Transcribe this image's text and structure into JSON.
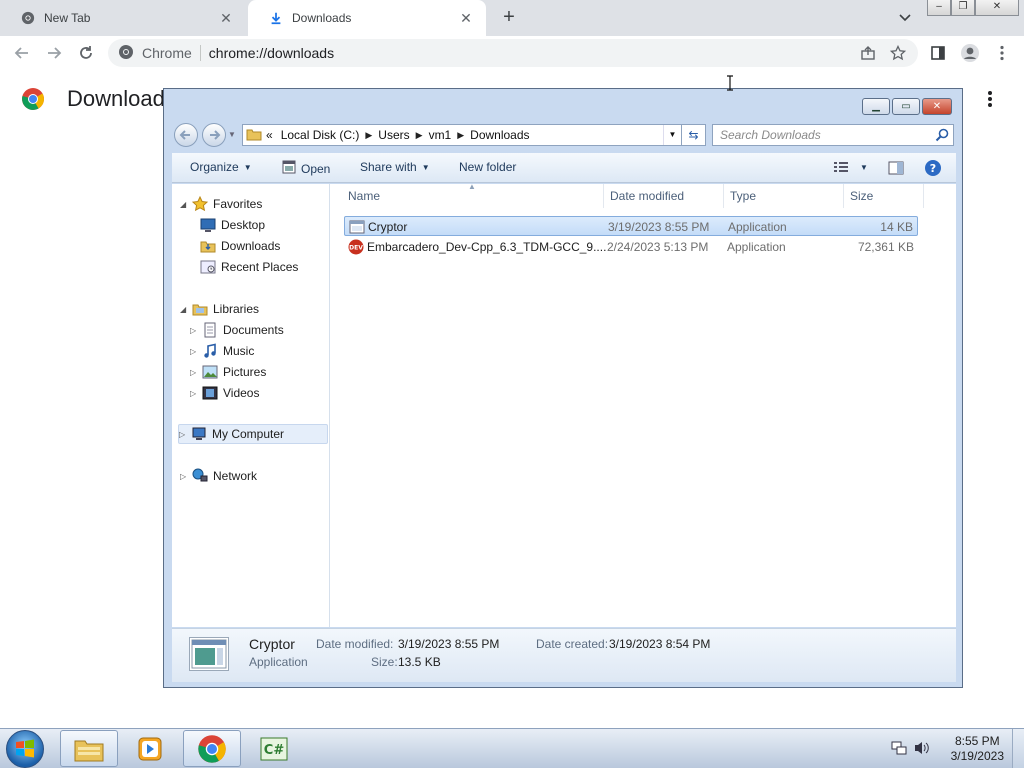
{
  "tabs": [
    {
      "title": "New Tab",
      "close": "✕"
    },
    {
      "title": "Downloads",
      "close": "✕"
    }
  ],
  "new_tab_label": "+",
  "omnibox": {
    "site": "Chrome",
    "url": "chrome://downloads"
  },
  "page": {
    "title": "Downloads"
  },
  "explorer": {
    "breadcrumb": {
      "overflow": "«",
      "parts": [
        "Local Disk (C:)",
        "Users",
        "vm1",
        "Downloads"
      ]
    },
    "search_placeholder": "Search Downloads",
    "commands": {
      "organize": "Organize",
      "open": "Open",
      "share_with": "Share with",
      "new_folder": "New folder"
    },
    "nav": {
      "favorites": "Favorites",
      "desktop": "Desktop",
      "downloads": "Downloads",
      "recent_places": "Recent Places",
      "libraries": "Libraries",
      "documents": "Documents",
      "music": "Music",
      "pictures": "Pictures",
      "videos": "Videos",
      "my_computer": "My Computer",
      "network": "Network"
    },
    "columns": [
      "Name",
      "Date modified",
      "Type",
      "Size"
    ],
    "files": [
      {
        "name": "Cryptor",
        "date": "3/19/2023 8:55 PM",
        "type": "Application",
        "size": "14 KB"
      },
      {
        "name": "Embarcadero_Dev-Cpp_6.3_TDM-GCC_9....",
        "date": "2/24/2023 5:13 PM",
        "type": "Application",
        "size": "72,361 KB"
      }
    ],
    "details": {
      "name": "Cryptor",
      "kind": "Application",
      "date_modified_label": "Date modified:",
      "date_modified": "3/19/2023 8:55 PM",
      "size_label": "Size:",
      "size": "13.5 KB",
      "date_created_label": "Date created:",
      "date_created": "3/19/2023 8:54 PM"
    }
  },
  "taskbar": {
    "time": "8:55 PM",
    "date": "3/19/2023"
  },
  "colors": {
    "chrome_tabstrip": "#dee1e6",
    "explorer_frame": "#c9daf0",
    "selection": "#c4dcf8",
    "taskbar": "#b9c8dc"
  }
}
